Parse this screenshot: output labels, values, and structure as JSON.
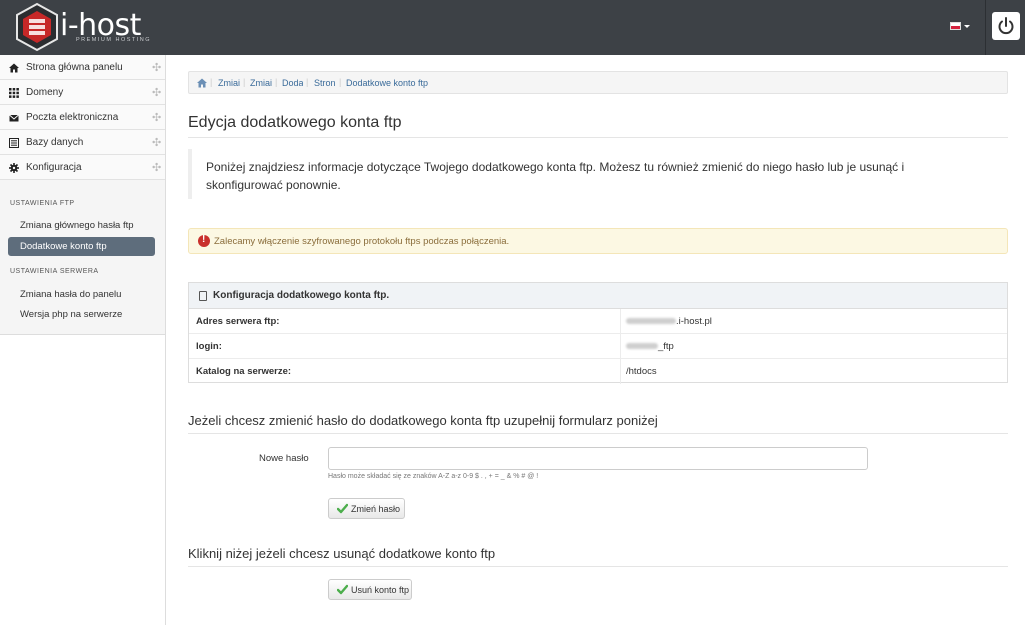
{
  "brand": {
    "name": "i-host",
    "tagline": "PREMIUM HOSTING",
    "accent": "#c9302c"
  },
  "header": {
    "language_flag": "flag-pl-icon",
    "power_icon": "power-icon"
  },
  "sidebar": {
    "items": [
      {
        "label": "Strona główna panelu",
        "icon": "home-icon"
      },
      {
        "label": "Domeny",
        "icon": "grid-icon"
      },
      {
        "label": "Poczta elektroniczna",
        "icon": "envelope-icon"
      },
      {
        "label": "Bazy danych",
        "icon": "list-icon"
      },
      {
        "label": "Konfiguracja",
        "icon": "gear-icon"
      }
    ],
    "sections": [
      {
        "title": "USTAWIENIA FTP",
        "items": [
          {
            "label": "Zmiana głównego hasła ftp",
            "active": false
          },
          {
            "label": "Dodatkowe konto ftp",
            "active": true
          }
        ]
      },
      {
        "title": "USTAWIENIA SERWERA",
        "items": [
          {
            "label": "Zmiana hasła do panelu",
            "active": false
          },
          {
            "label": "Wersja php na serwerze",
            "active": false
          }
        ]
      }
    ]
  },
  "breadcrumb": [
    "Zmiai",
    "Zmiai",
    "Doda",
    "Stron",
    "Dodatkowe konto ftp"
  ],
  "main": {
    "title": "Edycja dodatkowego konta ftp",
    "intro": "Poniżej znajdziesz informacje dotyczące Twojego dodatkowego konta ftp. Możesz tu również zmienić do niego hasło lub je usunąć i skonfigurować ponownie.",
    "alert": "Zalecamy włączenie szyfrowanego protokołu ftps podczas połączenia.",
    "panel": {
      "title": "Konfiguracja dodatkowego konta ftp.",
      "rows": [
        {
          "key": "Adres serwera ftp:",
          "value": ".i-host.pl"
        },
        {
          "key": "login:",
          "value": "_ftp"
        },
        {
          "key": "Katalog na serwerze:",
          "value": "/htdocs"
        }
      ]
    },
    "change_password": {
      "heading": "Jeżeli chcesz zmienić hasło do dodatkowego konta ftp uzupełnij formularz poniżej",
      "label": "Nowe hasło",
      "value": "",
      "help": "Hasło może składać się ze znaków A-Z a-z 0-9 $ . , + = _ & % # @ !",
      "button": "Zmień hasło"
    },
    "delete": {
      "heading": "Kliknij niżej jeżeli chcesz usunąć dodatkowe konto ftp",
      "button": "Usuń konto ftp"
    }
  }
}
